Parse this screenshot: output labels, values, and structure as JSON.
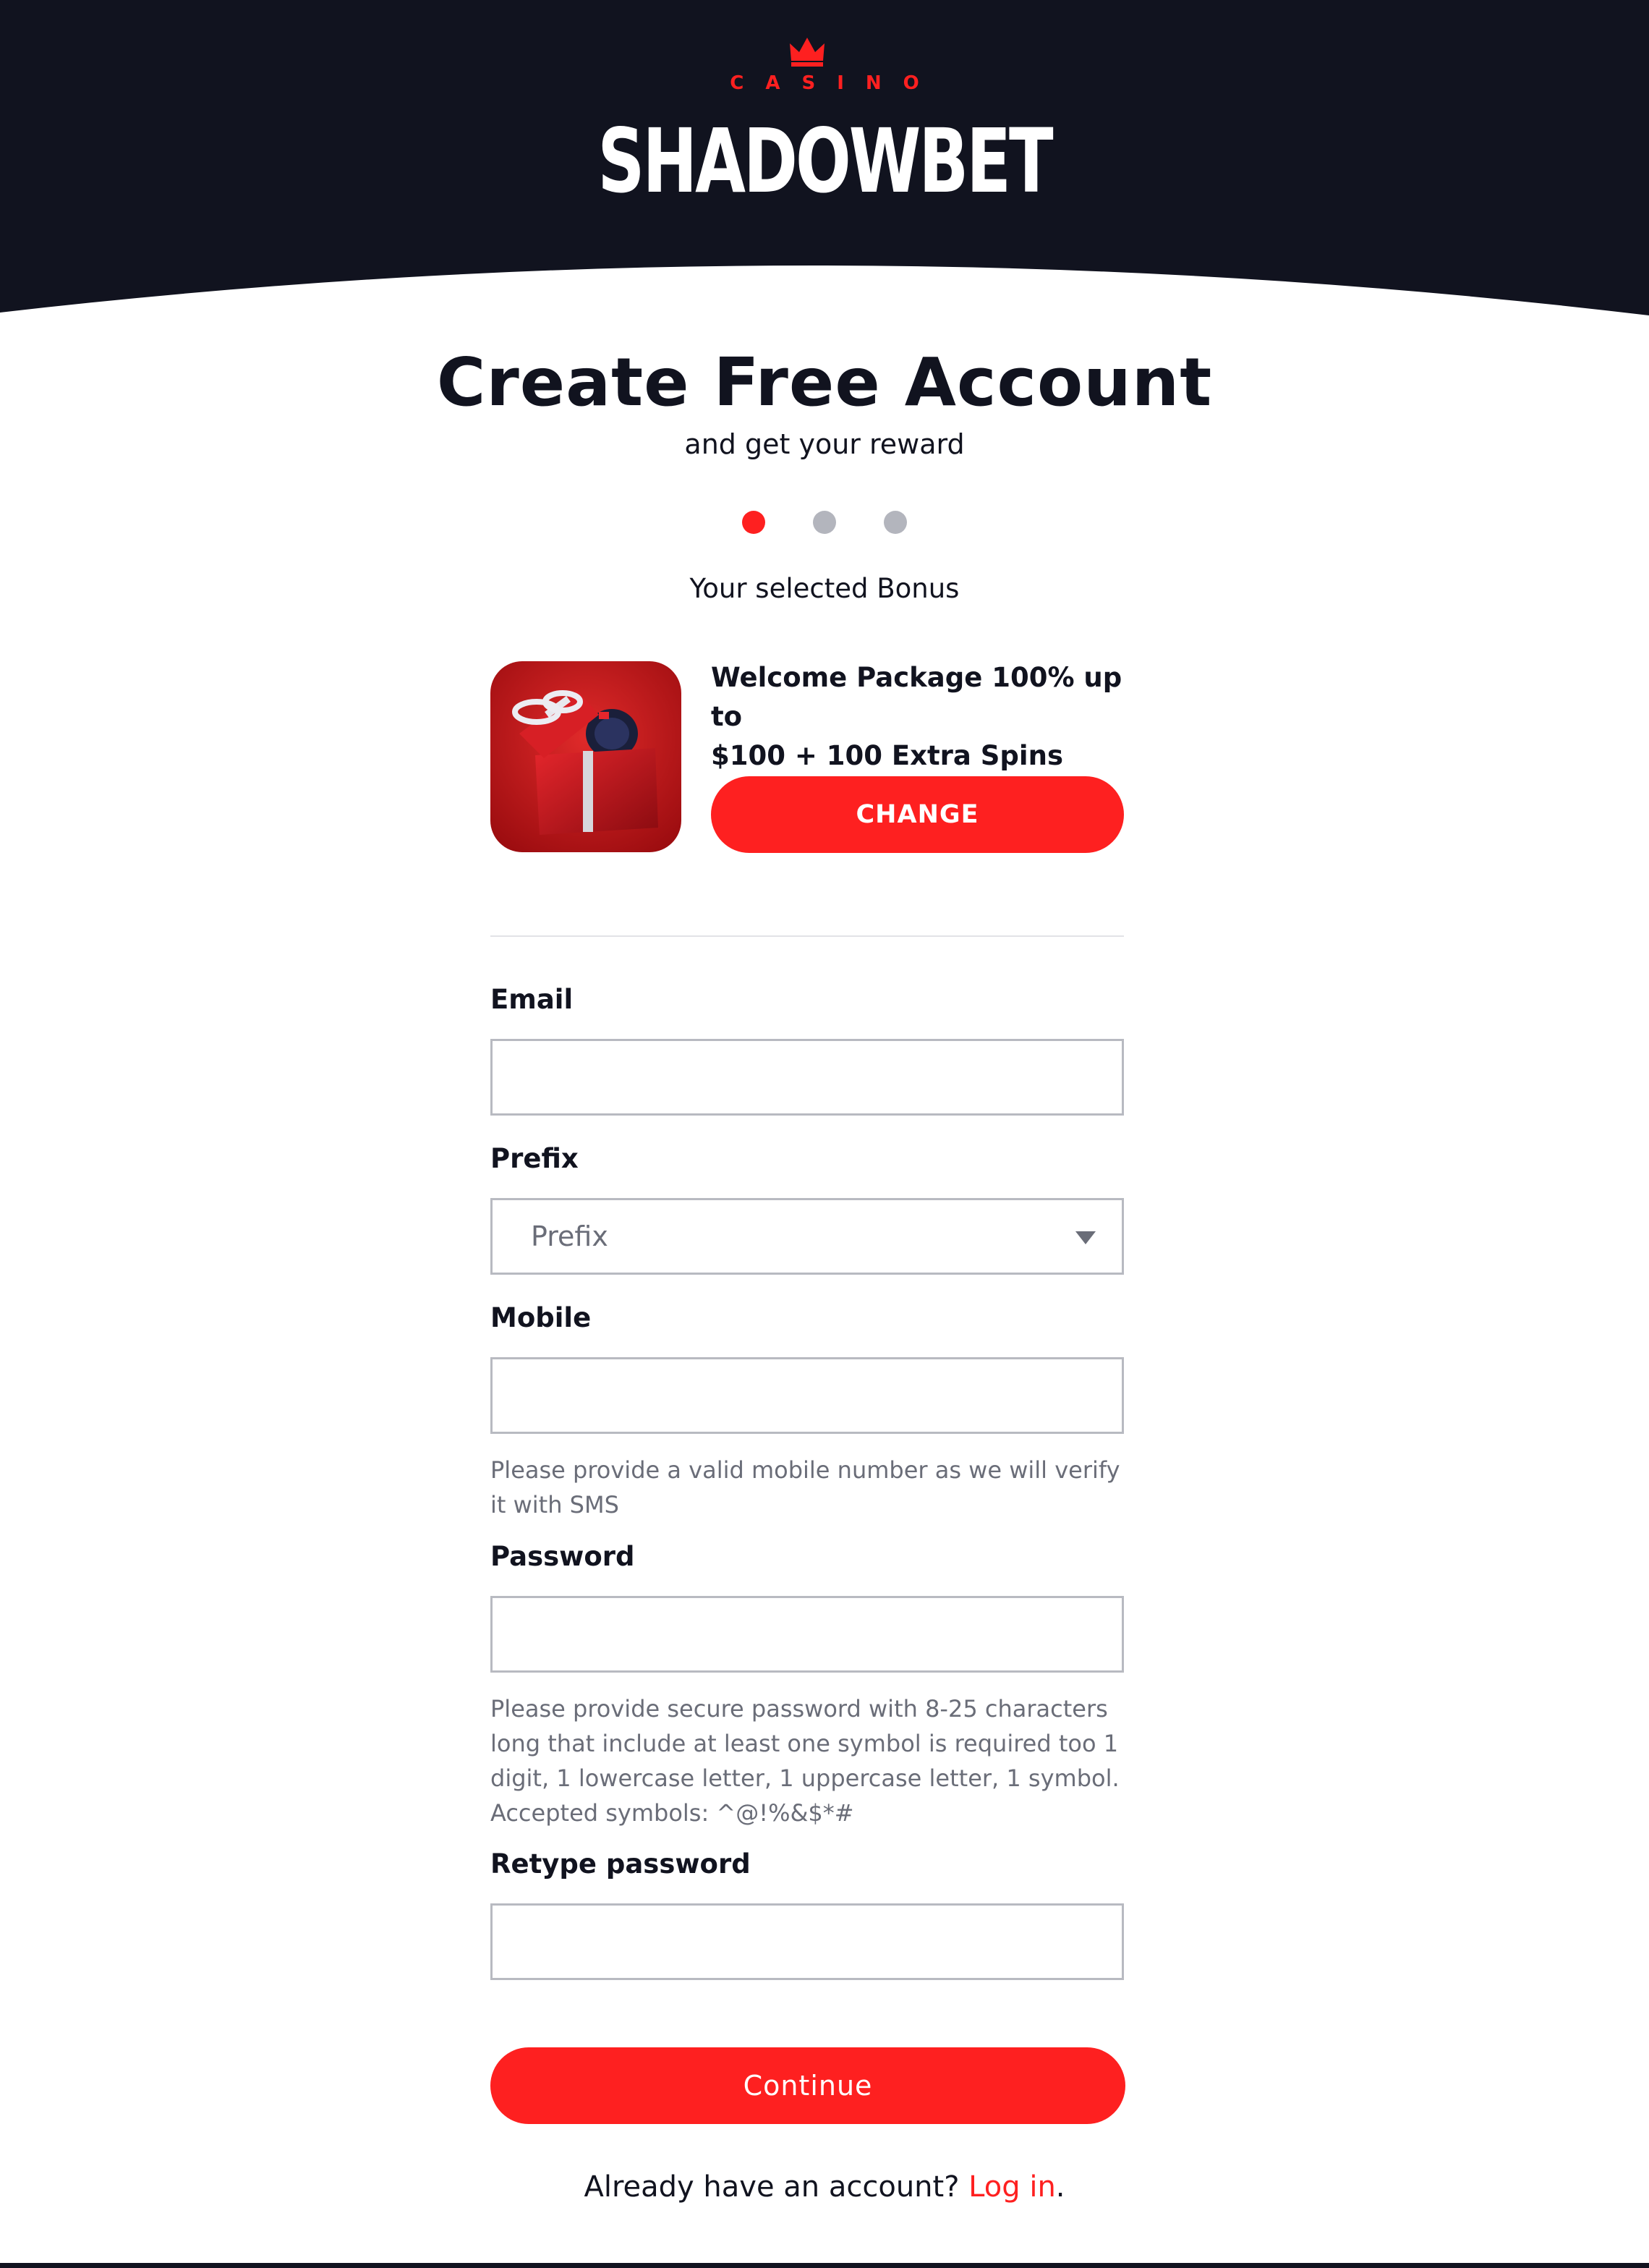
{
  "header": {
    "logo_top": "CASINO",
    "logo_brand": "SHADOWBET"
  },
  "page": {
    "title": "Create Free Account",
    "subtitle": "and get your reward",
    "steps_total": 3,
    "current_step": 1
  },
  "bonus": {
    "heading": "Your selected Bonus",
    "title_line1": "Welcome Package 100% up to",
    "title_line2": "$100 + 100 Extra Spins",
    "change_label": "CHANGE"
  },
  "form": {
    "email": {
      "label": "Email",
      "value": ""
    },
    "prefix": {
      "label": "Prefix",
      "placeholder": "Prefix"
    },
    "mobile": {
      "label": "Mobile",
      "value": "",
      "hint_line1": "Please provide a valid mobile number as we will verify",
      "hint_line2": "it with SMS"
    },
    "password": {
      "label": "Password",
      "value": "",
      "hint_line1": "Please provide secure password with 8-25 characters",
      "hint_line2": "long that include at least one symbol is required too 1",
      "hint_line3": "digit, 1 lowercase letter, 1 uppercase letter, 1 symbol.",
      "hint_line4": "Accepted symbols: ^@!%&$*#"
    },
    "retype": {
      "label": "Retype password",
      "value": ""
    },
    "continue_label": "Continue"
  },
  "footer": {
    "login_prompt": "Already have an account?",
    "login_link": "Log in",
    "login_suffix": "."
  },
  "colors": {
    "accent": "#fe2020",
    "header_bg": "#11131f",
    "step_inactive": "#b3b5bd",
    "hint_text": "#6a6d78"
  }
}
